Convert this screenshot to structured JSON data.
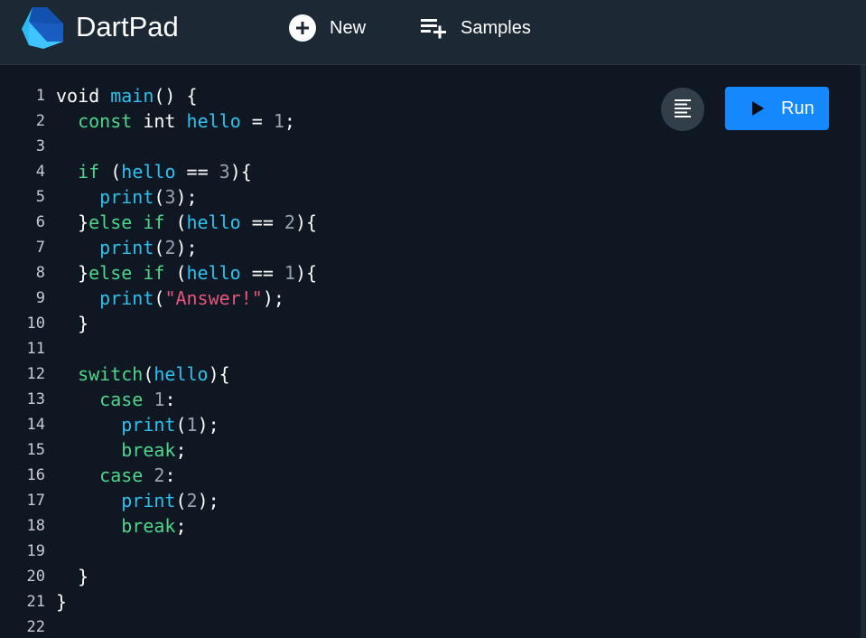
{
  "header": {
    "title": "DartPad",
    "new_label": "New",
    "samples_label": "Samples"
  },
  "editor": {
    "run_label": "Run",
    "line_numbers": [
      "1",
      "2",
      "3",
      "4",
      "5",
      "6",
      "7",
      "8",
      "9",
      "10",
      "11",
      "12",
      "13",
      "14",
      "15",
      "16",
      "17",
      "18",
      "19",
      "20",
      "21",
      "22"
    ],
    "lines": [
      [
        {
          "t": "void ",
          "c": "pl"
        },
        {
          "t": "main",
          "c": "fn"
        },
        {
          "t": "() {",
          "c": "pl"
        }
      ],
      [
        {
          "t": "  ",
          "c": "pl"
        },
        {
          "t": "const",
          "c": "kw"
        },
        {
          "t": " int ",
          "c": "pl"
        },
        {
          "t": "hello",
          "c": "fn"
        },
        {
          "t": " = ",
          "c": "pl"
        },
        {
          "t": "1",
          "c": "num"
        },
        {
          "t": ";",
          "c": "pl"
        }
      ],
      [],
      [
        {
          "t": "  ",
          "c": "pl"
        },
        {
          "t": "if",
          "c": "kw"
        },
        {
          "t": " (",
          "c": "pl"
        },
        {
          "t": "hello",
          "c": "fn"
        },
        {
          "t": " == ",
          "c": "pl"
        },
        {
          "t": "3",
          "c": "num"
        },
        {
          "t": "){",
          "c": "pl"
        }
      ],
      [
        {
          "t": "    ",
          "c": "pl"
        },
        {
          "t": "print",
          "c": "fn"
        },
        {
          "t": "(",
          "c": "pl"
        },
        {
          "t": "3",
          "c": "num"
        },
        {
          "t": ");",
          "c": "pl"
        }
      ],
      [
        {
          "t": "  }",
          "c": "pl"
        },
        {
          "t": "else if",
          "c": "kw"
        },
        {
          "t": " (",
          "c": "pl"
        },
        {
          "t": "hello",
          "c": "fn"
        },
        {
          "t": " == ",
          "c": "pl"
        },
        {
          "t": "2",
          "c": "num"
        },
        {
          "t": "){",
          "c": "pl"
        }
      ],
      [
        {
          "t": "    ",
          "c": "pl"
        },
        {
          "t": "print",
          "c": "fn"
        },
        {
          "t": "(",
          "c": "pl"
        },
        {
          "t": "2",
          "c": "num"
        },
        {
          "t": ");",
          "c": "pl"
        }
      ],
      [
        {
          "t": "  }",
          "c": "pl"
        },
        {
          "t": "else if",
          "c": "kw"
        },
        {
          "t": " (",
          "c": "pl"
        },
        {
          "t": "hello",
          "c": "fn"
        },
        {
          "t": " == ",
          "c": "pl"
        },
        {
          "t": "1",
          "c": "num"
        },
        {
          "t": "){",
          "c": "pl"
        }
      ],
      [
        {
          "t": "    ",
          "c": "pl"
        },
        {
          "t": "print",
          "c": "fn"
        },
        {
          "t": "(",
          "c": "pl"
        },
        {
          "t": "\"Answer!\"",
          "c": "str"
        },
        {
          "t": ");",
          "c": "pl"
        }
      ],
      [
        {
          "t": "  }",
          "c": "pl"
        }
      ],
      [],
      [
        {
          "t": "  ",
          "c": "pl"
        },
        {
          "t": "switch",
          "c": "kw"
        },
        {
          "t": "(",
          "c": "pl"
        },
        {
          "t": "hello",
          "c": "fn"
        },
        {
          "t": "){",
          "c": "pl"
        }
      ],
      [
        {
          "t": "    ",
          "c": "pl"
        },
        {
          "t": "case",
          "c": "kw"
        },
        {
          "t": " ",
          "c": "pl"
        },
        {
          "t": "1",
          "c": "num"
        },
        {
          "t": ":",
          "c": "pl"
        }
      ],
      [
        {
          "t": "      ",
          "c": "pl"
        },
        {
          "t": "print",
          "c": "fn"
        },
        {
          "t": "(",
          "c": "pl"
        },
        {
          "t": "1",
          "c": "num"
        },
        {
          "t": ");",
          "c": "pl"
        }
      ],
      [
        {
          "t": "      ",
          "c": "pl"
        },
        {
          "t": "break",
          "c": "kw"
        },
        {
          "t": ";",
          "c": "pl"
        }
      ],
      [
        {
          "t": "    ",
          "c": "pl"
        },
        {
          "t": "case",
          "c": "kw"
        },
        {
          "t": " ",
          "c": "pl"
        },
        {
          "t": "2",
          "c": "num"
        },
        {
          "t": ":",
          "c": "pl"
        }
      ],
      [
        {
          "t": "      ",
          "c": "pl"
        },
        {
          "t": "print",
          "c": "fn"
        },
        {
          "t": "(",
          "c": "pl"
        },
        {
          "t": "2",
          "c": "num"
        },
        {
          "t": ");",
          "c": "pl"
        }
      ],
      [
        {
          "t": "      ",
          "c": "pl"
        },
        {
          "t": "break",
          "c": "kw"
        },
        {
          "t": ";",
          "c": "pl"
        }
      ],
      [],
      [
        {
          "t": "  }",
          "c": "pl"
        }
      ],
      [
        {
          "t": "}",
          "c": "pl"
        }
      ],
      []
    ]
  },
  "icons": {
    "logo": "dart-logo-icon",
    "new": "add-circle-icon",
    "samples": "playlist-add-icon",
    "format": "format-align-icon",
    "run": "play-icon"
  },
  "colors": {
    "header_bg": "#1c2834",
    "editor_bg": "#0f1722",
    "run_button": "#1389fd",
    "keyword": "#4fd68b",
    "identifier": "#2ec1f0",
    "number": "#9aa3ad",
    "string": "#e8557a"
  }
}
